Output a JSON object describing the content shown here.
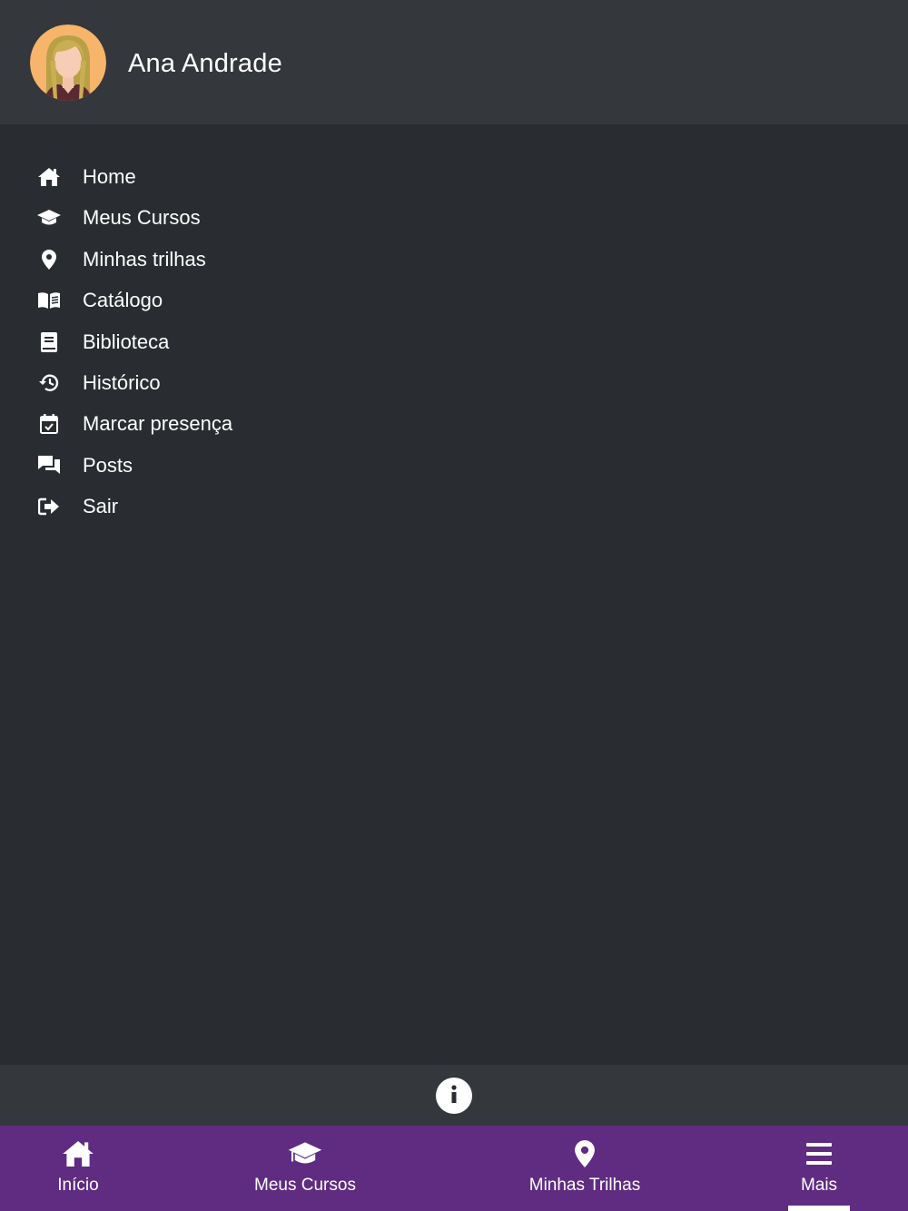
{
  "user": {
    "name": "Ana Andrade",
    "avatar": "avatar-woman"
  },
  "menu": {
    "items": [
      {
        "label": "Home",
        "icon": "home-icon"
      },
      {
        "label": "Meus Cursos",
        "icon": "graduation-cap-icon"
      },
      {
        "label": "Minhas trilhas",
        "icon": "map-pin-icon"
      },
      {
        "label": "Catálogo",
        "icon": "open-book-icon"
      },
      {
        "label": "Biblioteca",
        "icon": "book-icon"
      },
      {
        "label": "Histórico",
        "icon": "history-icon"
      },
      {
        "label": "Marcar presença",
        "icon": "calendar-check-icon"
      },
      {
        "label": "Posts",
        "icon": "chat-icon"
      },
      {
        "label": "Sair",
        "icon": "sign-out-icon"
      }
    ]
  },
  "info": {
    "icon": "info-icon"
  },
  "bottom_nav": {
    "tabs": [
      {
        "label": "Início",
        "icon": "home-icon"
      },
      {
        "label": "Meus Cursos",
        "icon": "graduation-cap-icon"
      },
      {
        "label": "Minhas Trilhas",
        "icon": "map-pin-icon"
      },
      {
        "label": "Mais",
        "icon": "hamburger-menu-icon"
      }
    ],
    "active_tab": "Mais"
  },
  "colors": {
    "header_bg": "#34373b",
    "background": "#292c30",
    "nav_bg": "#5f2c82",
    "text": "#ffffff"
  }
}
